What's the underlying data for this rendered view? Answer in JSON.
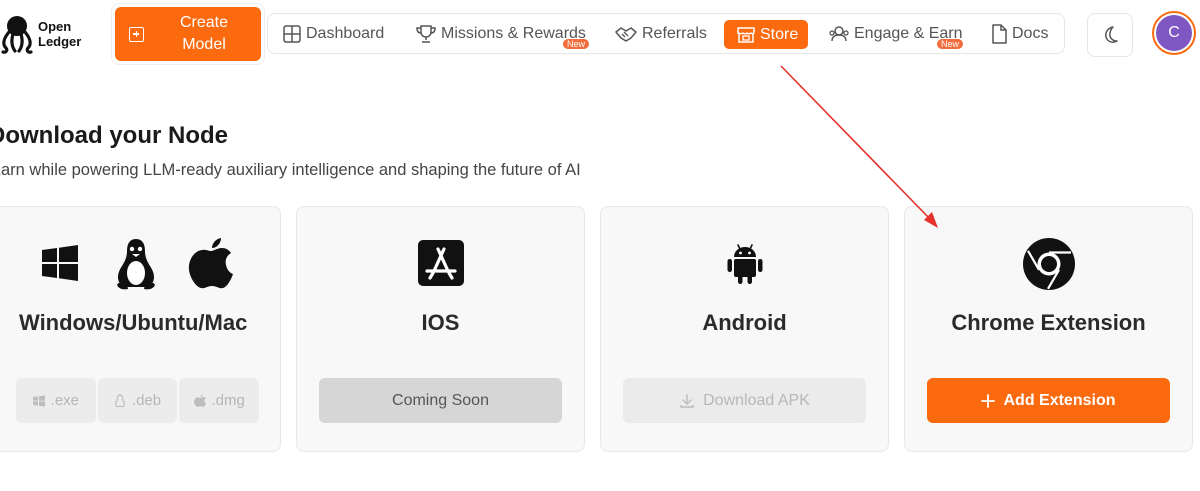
{
  "header": {
    "logo_line1": "Open",
    "logo_line2": "Ledger",
    "create_label": "Create Model",
    "nav": [
      {
        "label": "Dashboard",
        "icon": "grid-icon"
      },
      {
        "label": "Missions & Rewards",
        "icon": "trophy-icon",
        "badge": "New"
      },
      {
        "label": "Referrals",
        "icon": "handshake-icon"
      },
      {
        "label": "Store",
        "icon": "store-icon",
        "active": true
      },
      {
        "label": "Engage & Earn",
        "icon": "engage-icon",
        "badge": "New"
      },
      {
        "label": "Docs",
        "icon": "document-icon"
      }
    ],
    "avatar_initial": "C"
  },
  "hero": {
    "title": "Download your Node",
    "subtitle": "Earn while powering LLM-ready auxiliary intelligence and shaping the future of AI"
  },
  "cards": [
    {
      "title": "Windows/Ubuntu/Mac",
      "buttons": [
        ".exe",
        ".deb",
        ".dmg"
      ]
    },
    {
      "title": "IOS",
      "button": "Coming Soon"
    },
    {
      "title": "Android",
      "button": "Download APK"
    },
    {
      "title": "Chrome Extension",
      "button": "Add Extension"
    }
  ],
  "colors": {
    "accent": "#fb6a0f",
    "avatar": "#7e57c2",
    "badge": "#f26d3d",
    "annotation_arrow": "#e5322b"
  }
}
